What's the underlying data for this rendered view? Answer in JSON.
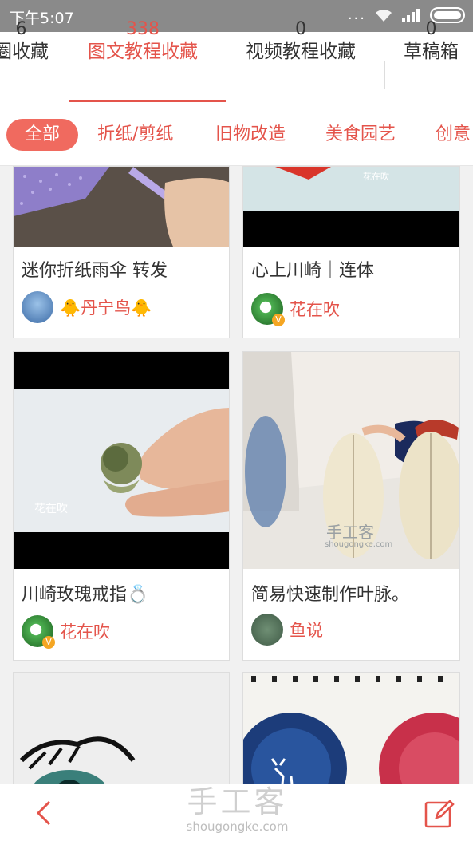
{
  "status_bar": {
    "time": "下午5:07",
    "dots": "...",
    "wifi_icon": "wifi-icon",
    "signal_icon": "signal-icon",
    "battery_icon": "battery-icon"
  },
  "stats": [
    {
      "num": "6",
      "label": "圈收藏",
      "active": false
    },
    {
      "num": "338",
      "label": "图文教程收藏",
      "active": true
    },
    {
      "num": "0",
      "label": "视频教程收藏",
      "active": false
    },
    {
      "num": "0",
      "label": "草稿箱",
      "active": false
    }
  ],
  "categories": [
    "全部",
    "折纸/剪纸",
    "旧物改造",
    "美食园艺",
    "创意"
  ],
  "cards": [
    {
      "title": "迷你折纸雨伞  转发",
      "author": "🐥丹宁鸟🐥"
    },
    {
      "title": "心上川崎｜连体",
      "author": "花在吹",
      "watermark": "花在吹"
    },
    {
      "title": "川崎玫瑰戒指💍",
      "author": "花在吹",
      "watermark": "花在吹"
    },
    {
      "title": "简易快速制作叶脉。",
      "author": "鱼说",
      "watermark": "手工客",
      "watermark_sub": "shougongke.com"
    },
    {
      "title": "",
      "author": ""
    },
    {
      "title": "",
      "author": ""
    }
  ],
  "bottom_bar": {
    "logo": "手工客",
    "logo_sub": "shougongke.com",
    "back_icon": "back-icon",
    "edit_icon": "edit-icon"
  },
  "colors": {
    "accent": "#e4544b",
    "status_bar": "#8a8a8a"
  }
}
